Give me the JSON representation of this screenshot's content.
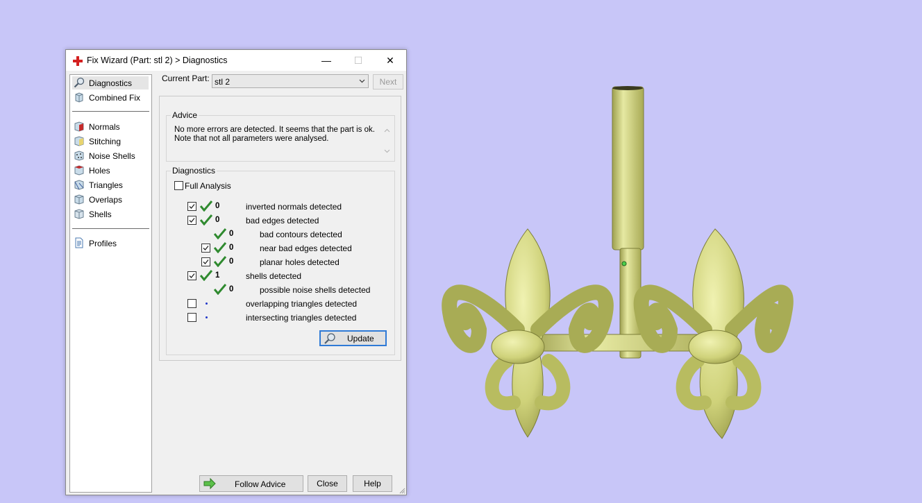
{
  "window": {
    "title": "Fix Wizard (Part: stl 2) > Diagnostics",
    "minimize_glyph": "—",
    "maximize_glyph": "☐",
    "close_glyph": "✕"
  },
  "sidebar": {
    "items": [
      {
        "label": "Diagnostics",
        "icon": "magnifier-icon",
        "selected": true
      },
      {
        "label": "Combined Fix",
        "icon": "cube-stack-icon"
      },
      {
        "label": "Normals",
        "icon": "normals-cube-icon"
      },
      {
        "label": "Stitching",
        "icon": "stitching-cube-icon"
      },
      {
        "label": "Noise Shells",
        "icon": "noise-shells-icon"
      },
      {
        "label": "Holes",
        "icon": "holes-cube-icon"
      },
      {
        "label": "Triangles",
        "icon": "triangles-cube-icon"
      },
      {
        "label": "Overlaps",
        "icon": "overlaps-cube-icon"
      },
      {
        "label": "Shells",
        "icon": "shells-cube-icon"
      },
      {
        "label": "Profiles",
        "icon": "document-icon"
      }
    ]
  },
  "top": {
    "current_part_label": "Current Part:",
    "current_part_value": "stl 2",
    "next_label": "Next"
  },
  "advice": {
    "title": "Advice",
    "line1": "No more errors are detected. It seems that the part is ok.",
    "line2": "Note that not all parameters were analysed."
  },
  "diagnostics": {
    "title": "Diagnostics",
    "full_analysis_label": "Full Analysis",
    "full_analysis_checked": false,
    "rows": [
      {
        "count": "0",
        "label": "inverted normals detected",
        "checked": true
      },
      {
        "count": "0",
        "label": "bad edges detected",
        "checked": true
      },
      {
        "count": "0",
        "label": "bad contours detected"
      },
      {
        "count": "0",
        "label": "near bad edges detected",
        "checked": true
      },
      {
        "count": "0",
        "label": "planar holes detected",
        "checked": true
      },
      {
        "count": "1",
        "label": "shells detected",
        "checked": true
      },
      {
        "count": "0",
        "label": "possible noise shells detected"
      },
      {
        "count": "",
        "label": "overlapping triangles detected",
        "checked": false
      },
      {
        "count": "",
        "label": "intersecting triangles detected",
        "checked": false
      }
    ],
    "update_label": "Update"
  },
  "footer": {
    "follow_advice_label": "Follow Advice",
    "close_label": "Close",
    "help_label": "Help"
  },
  "colors": {
    "background": "#c8c6f8",
    "model": "#d8dc8a",
    "check_green": "#2f8a2f",
    "focus_blue": "#2f7ad6"
  }
}
